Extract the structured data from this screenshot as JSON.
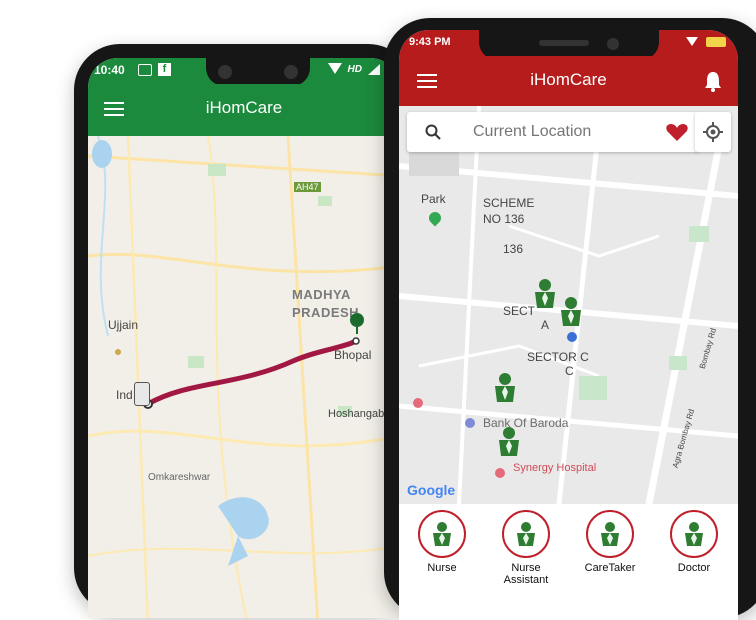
{
  "left_phone": {
    "status": {
      "time": "10:40",
      "net": "HD"
    },
    "appbar": {
      "title": "iHomCare",
      "color": "#1b8a3c"
    },
    "map_labels": {
      "road": "AH47",
      "state": "MADHYA PRADESH",
      "city1": "Ujjain",
      "city2": "Ind",
      "city3": "Bhopal",
      "city4": "Hoshangab",
      "place": "Omkareshwar"
    }
  },
  "right_phone": {
    "status": {
      "time": "9:43 PM"
    },
    "appbar": {
      "title": "iHomCare",
      "color": "#b71c1c"
    },
    "search": {
      "placeholder": "Current Location"
    },
    "map_labels": {
      "park": "Park",
      "scheme": "SCHEME",
      "no": "NO 136",
      "num": "136",
      "sector_a1": "SECT",
      "sector_a2": "A",
      "sector_c1": "SECTOR C",
      "sector_c2": "C",
      "bank": "Bank Of Baroda",
      "hospital": "Synergy Hospital",
      "road": "Agra Bombay Rd",
      "road2": "Bombay Rd",
      "google": "Google"
    },
    "tabs": [
      {
        "label": "Nurse"
      },
      {
        "label": "Nurse Assistant"
      },
      {
        "label": "CareTaker"
      },
      {
        "label": "Doctor"
      }
    ],
    "accent": "#c0202b",
    "pin_color": "#2e7d32"
  }
}
